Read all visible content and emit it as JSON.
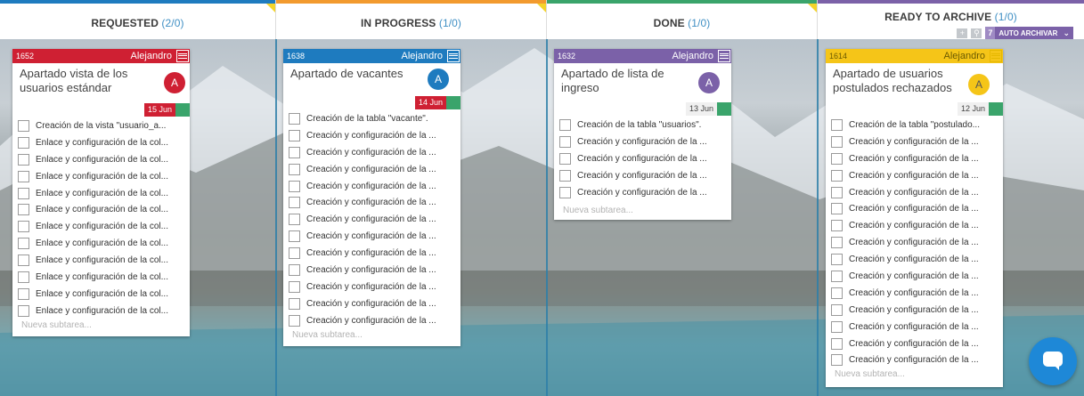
{
  "columns": [
    {
      "title": "REQUESTED",
      "count": "(2/0)",
      "color": "#1e7bbf"
    },
    {
      "title": "IN PROGRESS",
      "count": "(1/0)",
      "color": "#f29a2e"
    },
    {
      "title": "DONE",
      "count": "(1/0)",
      "color": "#3aa46b"
    },
    {
      "title": "READY TO ARCHIVE",
      "count": "(1/0)",
      "color": "#7b61a8"
    }
  ],
  "archive_tools": {
    "count": "7",
    "auto_label": "AUTO ARCHIVAR",
    "chevron": "chevron-down-icon"
  },
  "cards": [
    {
      "id": "1652",
      "owner": "Alejandro",
      "color": "#cf2033",
      "title": "Apartado vista de los usuarios estándar",
      "avatar": "A",
      "date": "15 Jun",
      "date_style": "overdue",
      "subtasks": [
        "Creación de la vista \"usuario_a...",
        "Enlace y configuración de la col...",
        "Enlace y configuración de la col...",
        "Enlace y configuración de la col...",
        "Enlace y configuración de la col...",
        "Enlace y configuración de la col...",
        "Enlace y configuración de la col...",
        "Enlace y configuración de la col...",
        "Enlace y configuración de la col...",
        "Enlace y configuración de la col...",
        "Enlace y configuración de la col...",
        "Enlace y configuración de la col..."
      ],
      "new_subtask": "Nueva subtarea..."
    },
    {
      "id": "1638",
      "owner": "Alejandro",
      "color": "#1e7bbf",
      "title": "Apartado de vacantes",
      "avatar": "A",
      "date": "14 Jun",
      "date_style": "overdue",
      "subtasks": [
        "Creación de la tabla \"vacante\".",
        "Creación y configuración de la ...",
        "Creación y configuración de la ...",
        "Creación y configuración de la ...",
        "Creación y configuración de la ...",
        "Creación y configuración de la ...",
        "Creación y configuración de la ...",
        "Creación y configuración de la ...",
        "Creación y configuración de la ...",
        "Creación y configuración de la ...",
        "Creación y configuración de la ...",
        "Creación y configuración de la ...",
        "Creación y configuración de la ..."
      ],
      "new_subtask": "Nueva subtarea..."
    },
    {
      "id": "1632",
      "owner": "Alejandro",
      "color": "#7b61a8",
      "title": "Apartado de lista de ingreso",
      "avatar": "A",
      "date": "13 Jun",
      "date_style": "normal",
      "subtasks": [
        "Creación de la tabla \"usuarios\".",
        "Creación y configuración de la ...",
        "Creación y configuración de la ...",
        "Creación y configuración de la ...",
        "Creación y configuración de la ..."
      ],
      "new_subtask": "Nueva subtarea..."
    },
    {
      "id": "1614",
      "owner": "Alejandro",
      "color": "#f5c518",
      "title": "Apartado de usuarios postulados rechazados",
      "avatar": "A",
      "date": "12 Jun",
      "date_style": "normal",
      "subtasks": [
        "Creación de la tabla \"postulado...",
        "Creación y configuración de la ...",
        "Creación y configuración de la ...",
        "Creación y configuración de la ...",
        "Creación y configuración de la ...",
        "Creación y configuración de la ...",
        "Creación y configuración de la ...",
        "Creación y configuración de la ...",
        "Creación y configuración de la ...",
        "Creación y configuración de la ...",
        "Creación y configuración de la ...",
        "Creación y configuración de la ...",
        "Creación y configuración de la ...",
        "Creación y configuración de la ...",
        "Creación y configuración de la ..."
      ],
      "new_subtask": "Nueva subtarea..."
    }
  ]
}
